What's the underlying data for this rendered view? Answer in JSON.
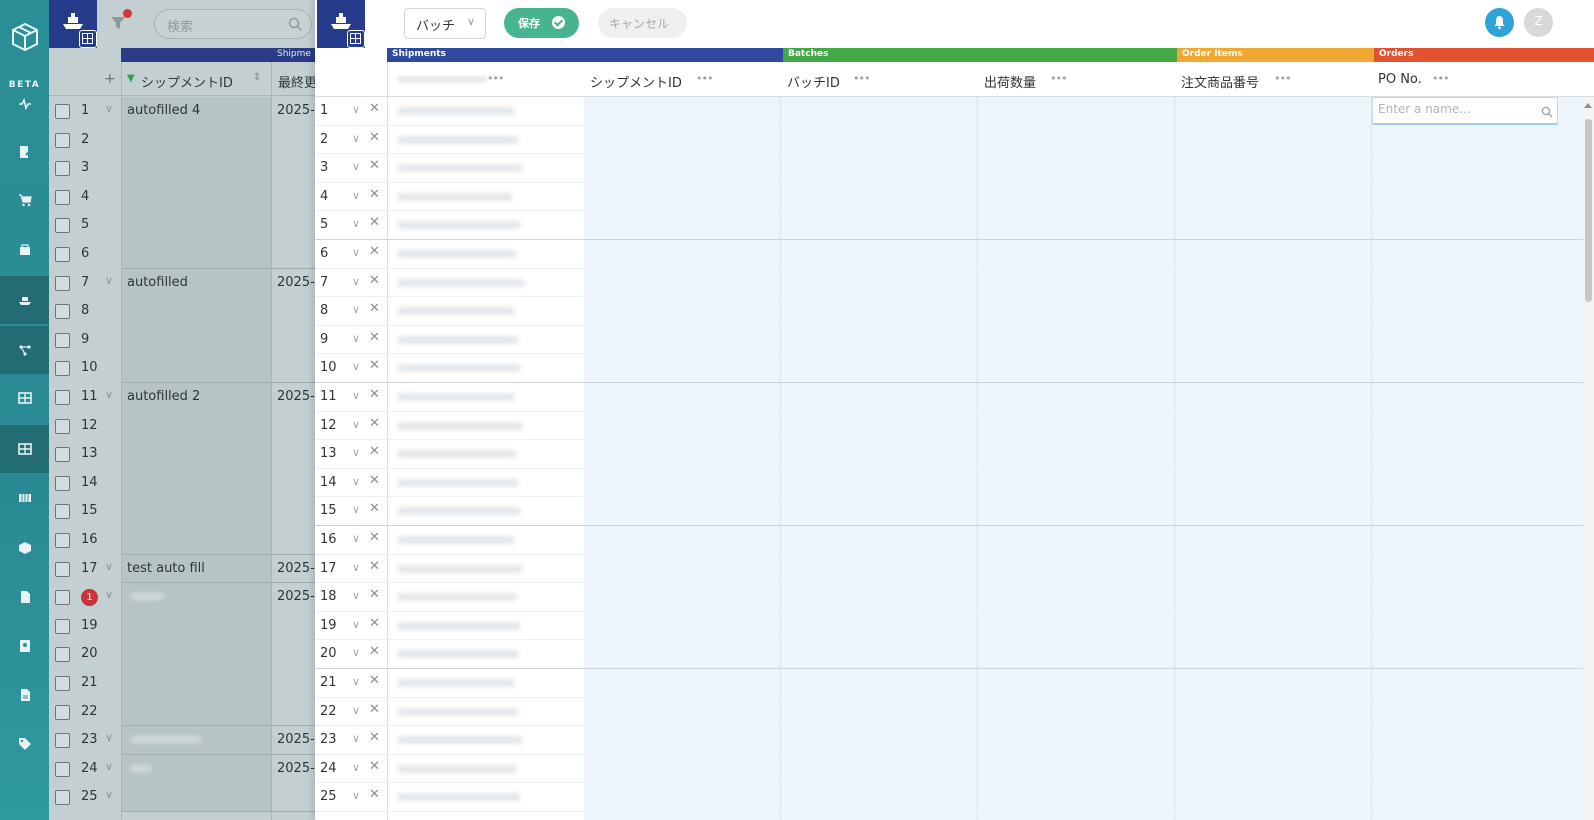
{
  "leftnav": {
    "beta_label": "BETA",
    "icons": [
      "activity-icon",
      "document-edit-icon",
      "cart-icon",
      "package-icon",
      "ship-icon",
      "network-icon",
      "table-icon",
      "table-alt-icon",
      "container-icon",
      "box-icon",
      "file-icon",
      "contact-icon",
      "sheet-icon",
      "tag-icon"
    ]
  },
  "background_table": {
    "search_placeholder": "検索",
    "group_label": "Shipme",
    "columns": [
      "シップメントID",
      "最終更"
    ],
    "add_column_symbol": "+",
    "rows": [
      "1",
      "2",
      "3",
      "4",
      "5",
      "6",
      "7",
      "8",
      "9",
      "10",
      "11",
      "12",
      "13",
      "14",
      "15",
      "16",
      "17",
      "18",
      "19",
      "20",
      "21",
      "22",
      "23",
      "24",
      "25"
    ],
    "badge_row_value": "1",
    "groups": [
      {
        "label": "autofilled 4",
        "date": "2025-0"
      },
      {
        "label": "autofilled",
        "date": "2025-"
      },
      {
        "label": "autofilled 2",
        "date": "2025-"
      },
      {
        "label": "test auto fill",
        "date": "2025-0"
      },
      {
        "label": "",
        "date": "2025-0"
      },
      {
        "label": "",
        "date": "2025-0"
      },
      {
        "label": "",
        "date": "2025-0"
      }
    ]
  },
  "panel": {
    "batch_select_value": "バッチ",
    "save_label": "保存",
    "cancel_label": "キャンセル",
    "avatar_initial": "Z",
    "groups": [
      {
        "label": "Shipments",
        "color": "#2d4aa0"
      },
      {
        "label": "Batches",
        "color": "#43a846"
      },
      {
        "label": "Order Items",
        "color": "#f0a833"
      },
      {
        "label": "Orders",
        "color": "#e2522e"
      }
    ],
    "columns": [
      "",
      "シップメントID",
      "バッチID",
      "出荷数量",
      "注文商品番号",
      "PO No."
    ],
    "po_input_placeholder": "Enter a name...",
    "rows": [
      "1",
      "2",
      "3",
      "4",
      "5",
      "6",
      "7",
      "8",
      "9",
      "10",
      "11",
      "12",
      "13",
      "14",
      "15",
      "16",
      "17",
      "18",
      "19",
      "20",
      "21",
      "22",
      "23",
      "24",
      "25"
    ]
  }
}
